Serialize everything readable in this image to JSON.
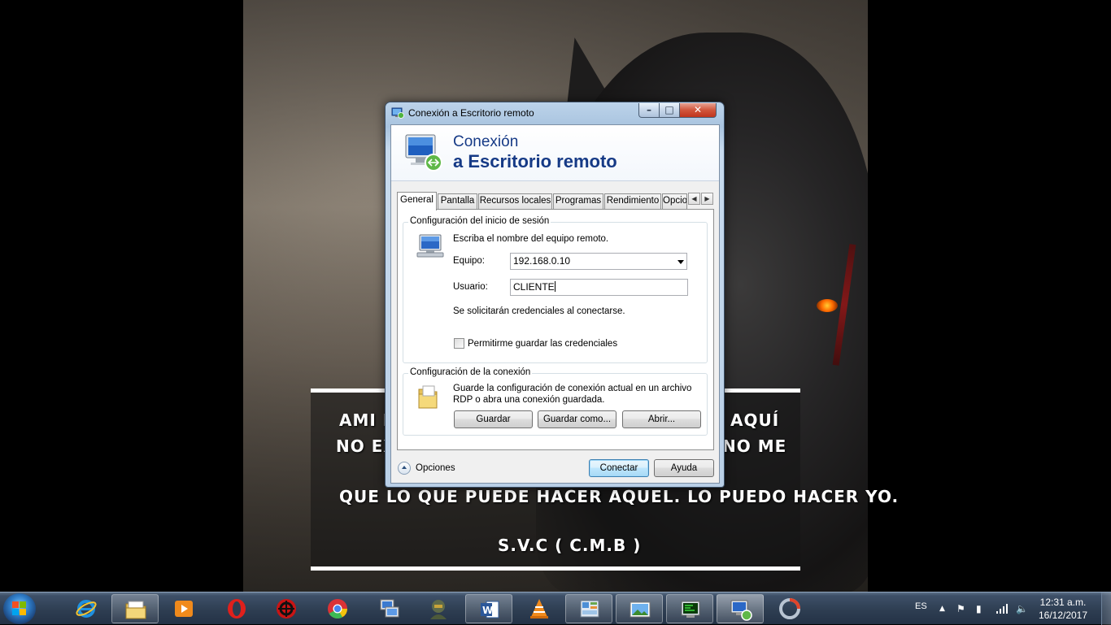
{
  "window": {
    "title": "Conexión a Escritorio remoto",
    "header_line1": "Conexión",
    "header_line2": "a Escritorio remoto"
  },
  "tabs": [
    {
      "label": "General",
      "active": true
    },
    {
      "label": "Pantalla"
    },
    {
      "label": "Recursos locales"
    },
    {
      "label": "Programas"
    },
    {
      "label": "Rendimiento"
    },
    {
      "label": "Opcio"
    }
  ],
  "login_group": {
    "title": "Configuración del inicio de sesión",
    "instruction": "Escriba el nombre del equipo remoto.",
    "computer_label": "Equipo:",
    "computer_value": "192.168.0.10",
    "user_label": "Usuario:",
    "user_value": "CLIENTE",
    "credentials_note": "Se solicitarán credenciales al conectarse.",
    "save_credentials_label": "Permitirme guardar las credenciales",
    "save_credentials_checked": false
  },
  "connection_group": {
    "title": "Configuración de la conexión",
    "description_line1": "Guarde la configuración de conexión actual en un archivo",
    "description_line2": "RDP o abra una conexión guardada.",
    "save_label": "Guardar",
    "save_as_label": "Guardar como...",
    "open_label": "Abrir..."
  },
  "footer": {
    "options_label": "Opciones",
    "connect_label": "Conectar",
    "help_label": "Ayuda"
  },
  "wallpaper": {
    "quote_line1_left": "AMI D",
    "quote_line1_right": "AQUÍ",
    "quote_line2_left": "NO EX",
    "quote_line2_right": "NO ME",
    "quote_line3": "QUE LO QUE PUEDE HACER AQUEL. LO PUEDO HACER YO.",
    "signature": "S.V.C ( C.M.B )"
  },
  "taskbar": {
    "items": [
      {
        "name": "internet-explorer-icon"
      },
      {
        "name": "file-explorer-icon"
      },
      {
        "name": "media-player-icon"
      },
      {
        "name": "opera-icon"
      },
      {
        "name": "app-red-icon"
      },
      {
        "name": "chrome-icon"
      },
      {
        "name": "network-computer-icon"
      },
      {
        "name": "game-soldier-icon"
      },
      {
        "name": "word-icon"
      },
      {
        "name": "vlc-icon"
      },
      {
        "name": "control-panel-icon"
      },
      {
        "name": "photo-viewer-icon"
      },
      {
        "name": "terminal-icon"
      },
      {
        "name": "remote-desktop-icon"
      },
      {
        "name": "app-circle-icon"
      }
    ],
    "language": "ES",
    "time": "12:31 a.m.",
    "date": "16/12/2017"
  },
  "colors": {
    "header_text": "#163a86",
    "taskbar": "#2e3e52",
    "close_button": "#c0351d"
  }
}
